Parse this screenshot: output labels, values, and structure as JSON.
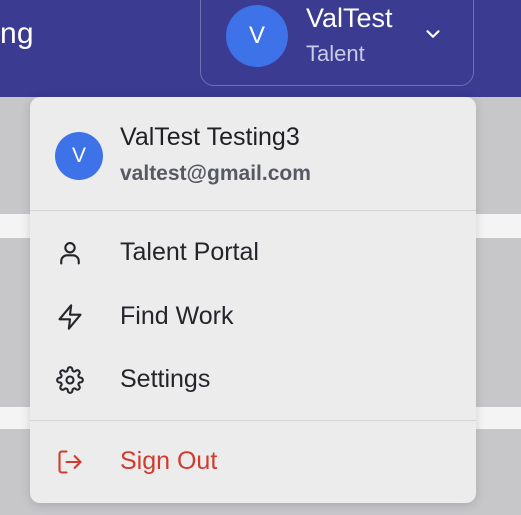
{
  "header": {
    "left_text_fragment": "ng",
    "account": {
      "avatar_initial": "V",
      "name": "ValTest",
      "role": "Talent",
      "chevron_icon": "chevron-down-icon"
    }
  },
  "menu": {
    "user": {
      "avatar_initial": "V",
      "full_name": "ValTest Testing3",
      "email": "valtest@gmail.com"
    },
    "items": [
      {
        "label": "Talent Portal",
        "icon": "user-icon"
      },
      {
        "label": "Find Work",
        "icon": "lightning-icon"
      },
      {
        "label": "Settings",
        "icon": "gear-icon"
      }
    ],
    "sign_out": {
      "label": "Sign Out",
      "icon": "sign-out-icon"
    }
  },
  "colors": {
    "header_bg": "#3a3b91",
    "avatar_bg": "#3d72e8",
    "menu_bg": "#ececed",
    "sign_out_red": "#cf3b2c"
  }
}
